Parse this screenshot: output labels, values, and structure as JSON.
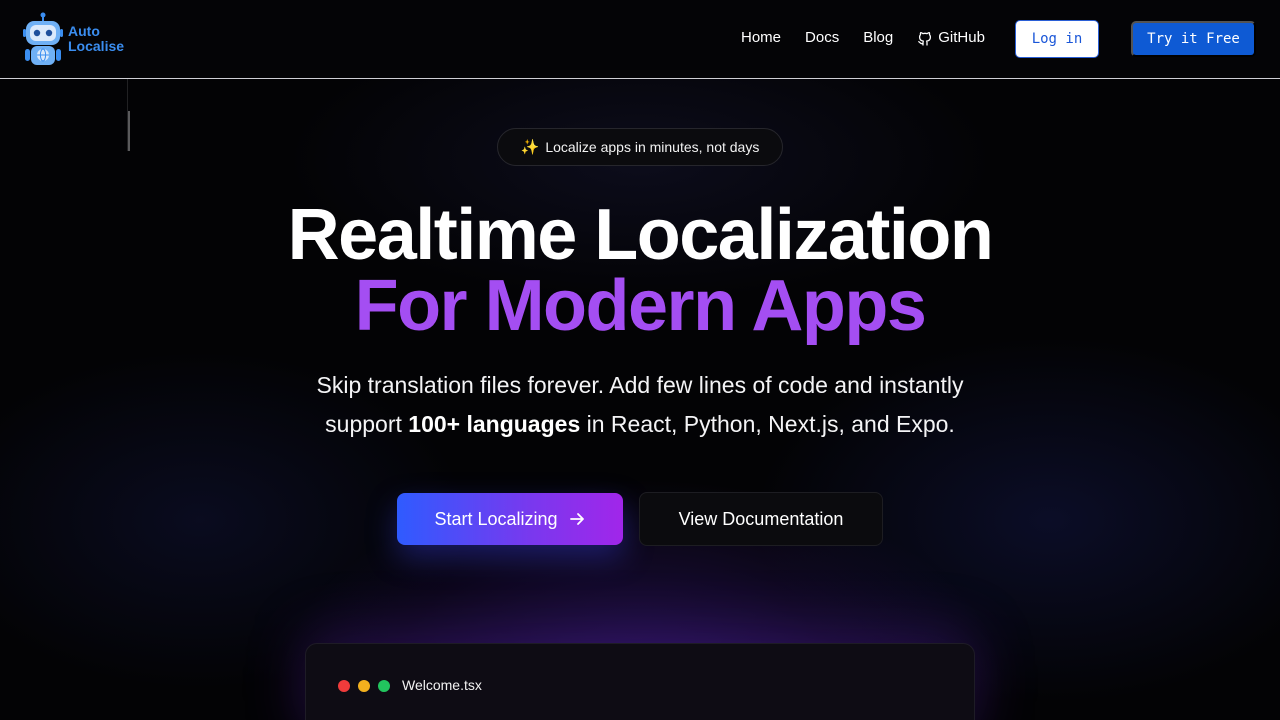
{
  "brand": {
    "line1": "Auto",
    "line2": "Localise"
  },
  "nav": {
    "links": [
      "Home",
      "Docs",
      "Blog"
    ],
    "github": "GitHub",
    "login": "Log in",
    "try_free": "Try it Free"
  },
  "hero": {
    "pill_icon": "sparkles-icon",
    "pill_text": "Localize apps in minutes, not days",
    "title_line1": "Realtime Localization",
    "title_line2": "For Modern Apps",
    "subtitle_part1": "Skip translation files forever. Add few lines of code and instantly",
    "subtitle_part2a": "support ",
    "subtitle_bold": "100+ languages",
    "subtitle_part2b": " in React, Python, Next.js, and Expo.",
    "cta_primary": "Start Localizing",
    "cta_secondary": "View Documentation"
  },
  "editor": {
    "filename": "Welcome.tsx"
  },
  "colors": {
    "accent_purple": "#a44ef2",
    "brand_blue": "#0e5ad4",
    "logo_blue": "#3b8ef0"
  }
}
